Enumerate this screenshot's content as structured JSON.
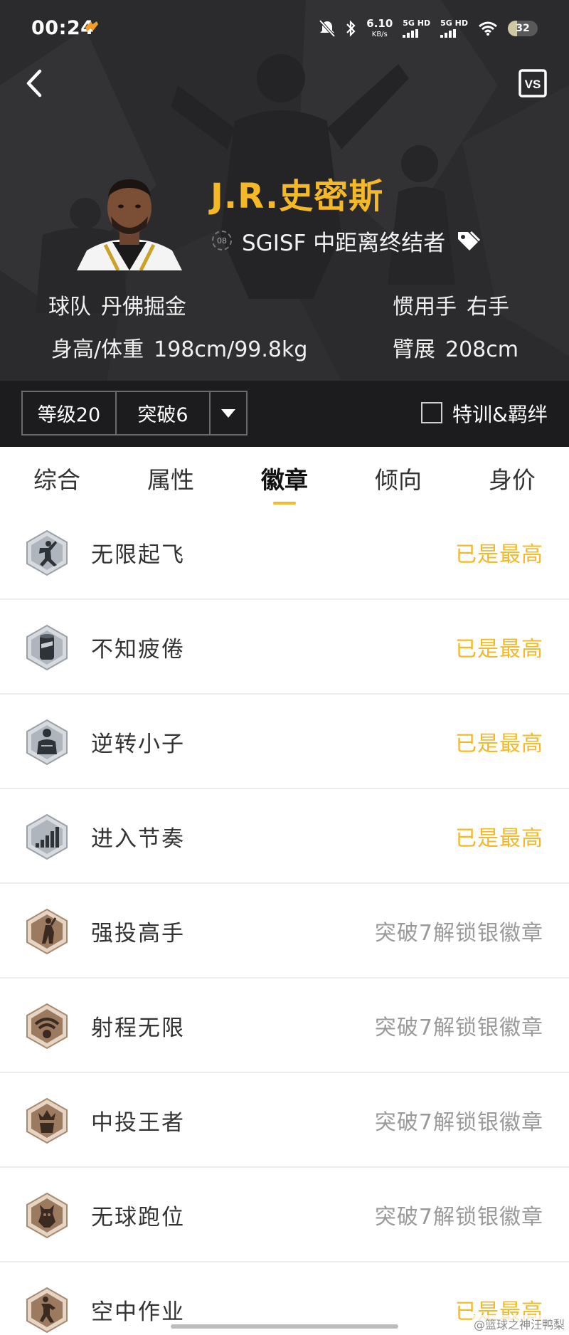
{
  "status_bar": {
    "time": "00:24",
    "net_speed": "6.10",
    "net_speed_unit": "KB/s",
    "sim1": "5G HD",
    "sim2": "5G HD",
    "battery": "32",
    "battery_level": 0.32
  },
  "colors": {
    "accent": "#f5b827",
    "muted": "#9a9a9a",
    "dark": "#2a2a2d"
  },
  "header": {
    "back_icon": "chevron-left-icon",
    "vs_label": "VS",
    "player_name": "J.R.史密斯",
    "jersey_number": "08",
    "badge_title": "SGISF 中距离终结者",
    "tag_icon": "tag-icon",
    "team_label": "球队",
    "team_value": "丹佛掘金",
    "hand_label": "惯用手",
    "hand_value": "右手",
    "body_label": "身高/体重",
    "body_value": "198cm/99.8kg",
    "wingspan_label": "臂展",
    "wingspan_value": "208cm"
  },
  "controls": {
    "level": "等级20",
    "breakthrough": "突破6",
    "checkbox_label": "特训&羁绊",
    "checkbox_checked": false
  },
  "tabs": {
    "active_index": 2,
    "items": [
      "综合",
      "属性",
      "徽章",
      "倾向",
      "身价"
    ]
  },
  "badges": [
    {
      "name": "无限起飞",
      "status": "已是最高",
      "tier": "silver",
      "icon": "dunk-player-icon"
    },
    {
      "name": "不知疲倦",
      "status": "已是最高",
      "tier": "silver",
      "icon": "energy-can-icon"
    },
    {
      "name": "逆转小子",
      "status": "已是最高",
      "tier": "silver",
      "icon": "comeback-player-icon"
    },
    {
      "name": "进入节奏",
      "status": "已是最高",
      "tier": "silver",
      "icon": "rhythm-bars-icon"
    },
    {
      "name": "强投高手",
      "status": "突破7解锁银徽章",
      "tier": "bronze",
      "icon": "contested-shooter-icon"
    },
    {
      "name": "射程无限",
      "status": "突破7解锁银徽章",
      "tier": "bronze",
      "icon": "range-wifi-icon"
    },
    {
      "name": "中投王者",
      "status": "突破7解锁银徽章",
      "tier": "bronze",
      "icon": "mid-range-king-icon"
    },
    {
      "name": "无球跑位",
      "status": "突破7解锁银徽章",
      "tier": "bronze",
      "icon": "off-ball-runner-icon"
    },
    {
      "name": "空中作业",
      "status": "已是最高",
      "tier": "bronze",
      "icon": "aerial-player-icon"
    }
  ],
  "watermark": "@篮球之神汪鸭梨"
}
